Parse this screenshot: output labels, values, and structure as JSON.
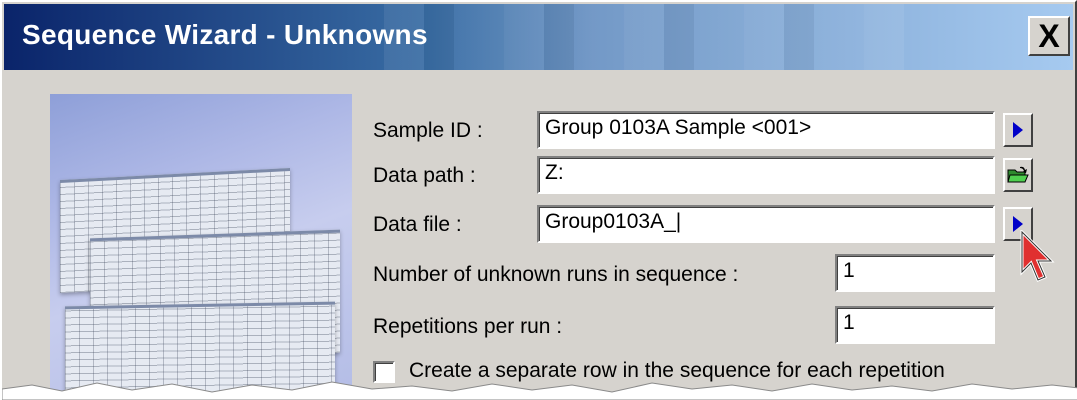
{
  "window": {
    "title": "Sequence Wizard - Unknowns",
    "close_label": "X"
  },
  "fields": {
    "sample_id": {
      "label": "Sample ID :",
      "value": "Group 0103A Sample <001>"
    },
    "data_path": {
      "label": "Data path :",
      "value": "Z:"
    },
    "data_file": {
      "label": "Data file :",
      "value": "Group0103A_|"
    },
    "unknown_runs": {
      "label": "Number of unknown runs in sequence :",
      "value": "1"
    },
    "repetitions": {
      "label": "Repetitions per run :",
      "value": "1"
    }
  },
  "separate_row_checkbox": {
    "label": "Create a separate row in the sequence for each repetition",
    "checked": false
  },
  "icons": {
    "sample_id_button": "play-arrow-icon",
    "data_path_button": "open-folder-icon",
    "data_file_button": "play-arrow-icon",
    "cursor": "mouse-pointer-icon"
  },
  "colors": {
    "title_start": "#0a246a",
    "title_end": "#a6caf0",
    "dialog_bg": "#d6d3ce",
    "arrow": "#0000c8",
    "folder": "#3cb043",
    "cursor": "#e03030"
  }
}
